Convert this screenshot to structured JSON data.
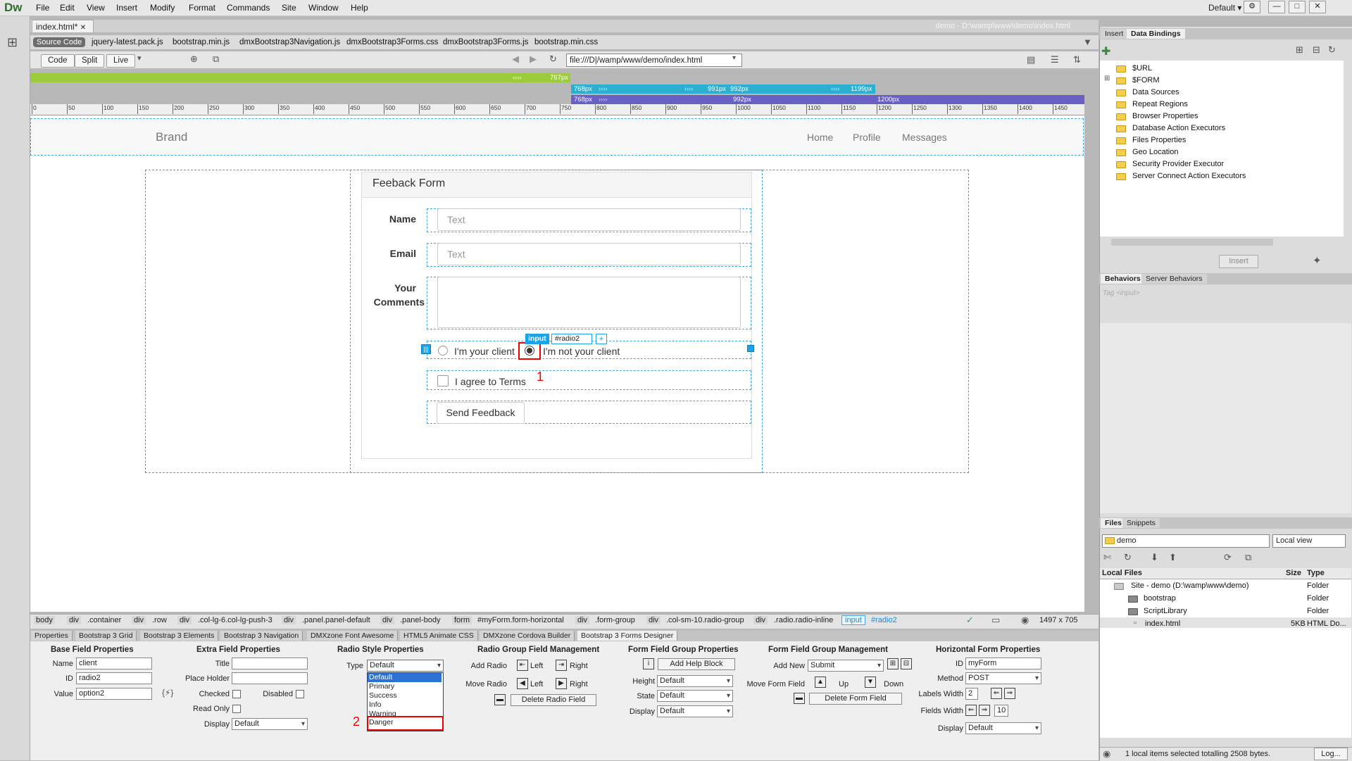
{
  "app": {
    "logo": "Dw",
    "menu": [
      "File",
      "Edit",
      "View",
      "Insert",
      "Modify",
      "Format",
      "Commands",
      "Site",
      "Window",
      "Help"
    ],
    "workspace": "Default"
  },
  "document": {
    "tab": "index.html*",
    "path": "demo - D:\\wamp\\www\\demo\\index.html",
    "related_files": [
      "Source Code",
      "jquery-latest.pack.js",
      "bootstrap.min.js",
      "dmxBootstrap3Navigation.js",
      "dmxBootstrap3Forms.css",
      "dmxBootstrap3Forms.js",
      "bootstrap.min.css"
    ],
    "view_buttons": [
      "Code",
      "Split",
      "Live"
    ],
    "address": "file:///D|/wamp/www/demo/index.html"
  },
  "media_queries": {
    "row1": "767px",
    "row2": [
      "768px",
      "991px",
      "992px",
      "1199px"
    ],
    "row3": [
      "768px",
      "992px",
      "1200px"
    ]
  },
  "ruler": [
    "0",
    "50",
    "100",
    "150",
    "200",
    "250",
    "300",
    "350",
    "400",
    "450",
    "500",
    "550",
    "600",
    "650",
    "700",
    "750",
    "800",
    "850",
    "900",
    "950",
    "1000",
    "1050",
    "1100",
    "1150",
    "1200",
    "1250",
    "1300",
    "1350",
    "1400",
    "1450"
  ],
  "page": {
    "brand": "Brand",
    "nav": [
      "Home",
      "Profile",
      "Messages"
    ],
    "panel_title": "Feeback Form",
    "fields": {
      "name_label": "Name",
      "name_placeholder": "Text",
      "email_label": "Email",
      "email_placeholder": "Text",
      "comments_label_1": "Your",
      "comments_label_2": "Comments"
    },
    "radios": [
      "I'm your client",
      "I'm not your client"
    ],
    "checkbox": "I agree to Terms",
    "submit": "Send Feedback",
    "selected_tag": "input",
    "selected_id": "#radio2",
    "annotation_1": "1",
    "annotation_2": "2"
  },
  "tag_selector": {
    "crumbs": [
      "body",
      "div",
      ".container",
      "div",
      ".row",
      "div",
      ".col-lg-6.col-lg-push-3",
      "div",
      ".panel.panel-default",
      "div",
      ".panel-body",
      "form",
      "#myForm.form-horizontal",
      "div",
      ".form-group",
      "div",
      ".col-sm-10.radio-group",
      "div",
      ".radio.radio-inline"
    ],
    "current_tag": "input",
    "current_id": "#radio2",
    "size": "1497 x 705"
  },
  "properties": {
    "tabs": [
      "Properties",
      "Bootstrap 3 Grid",
      "Bootstrap 3 Elements",
      "Bootstrap 3 Navigation",
      "DMXzone Font Awesome",
      "HTML5 Animate CSS",
      "DMXzone Cordova Builder",
      "Bootstrap 3 Forms Designer"
    ],
    "base": {
      "title": "Base Field Properties",
      "name_label": "Name",
      "name": "client",
      "id_label": "ID",
      "id": "radio2",
      "value_label": "Value",
      "value": "option2"
    },
    "extra": {
      "title": "Extra Field Properties",
      "title_label": "Title",
      "placeholder_label": "Place Holder",
      "checked_label": "Checked",
      "disabled_label": "Disabled",
      "readonly_label": "Read Only",
      "display_label": "Display",
      "display": "Default"
    },
    "radio_style": {
      "title": "Radio Style Properties",
      "type_label": "Type",
      "type": "Default",
      "options": [
        "Default",
        "Primary",
        "Success",
        "Info",
        "Warning",
        "Danger"
      ]
    },
    "radio_group": {
      "title": "Radio Group Field Management",
      "add_label": "Add Radio",
      "move_label": "Move Radio",
      "left": "Left",
      "right": "Right",
      "delete": "Delete Radio Field"
    },
    "form_group": {
      "title": "Form Field Group Properties",
      "help": "Add Help Block",
      "height_label": "Height",
      "height": "Default",
      "state_label": "State",
      "state": "Default",
      "display_label": "Display",
      "display": "Default"
    },
    "form_mgmt": {
      "title": "Form Field Group Management",
      "add_new_label": "Add New",
      "add_new": "Submit",
      "move_label": "Move Form Field",
      "up": "Up",
      "down": "Down",
      "delete": "Delete Form Field"
    },
    "horizontal": {
      "title": "Horizontal Form Properties",
      "id_label": "ID",
      "id": "myForm",
      "method_label": "Method",
      "method": "POST",
      "labels_width_label": "Labels Width",
      "labels_width": "2",
      "fields_width_label": "Fields Width",
      "fields_width": "10",
      "display_label": "Display",
      "display": "Default"
    }
  },
  "right_panel": {
    "tabs1": [
      "Insert",
      "Data Bindings"
    ],
    "bindings": [
      "$URL",
      "$FORM",
      "Data Sources",
      "Repeat Regions",
      "Browser Properties",
      "Database Action Executors",
      "Files Properties",
      "Geo Location",
      "Security Provider Executor",
      "Server Connect Action Executors"
    ],
    "insert_button": "Insert",
    "tabs2": [
      "Behaviors",
      "Server Behaviors"
    ],
    "tag_placeholder": "Tag <input>",
    "tabs3": [
      "Files",
      "Snippets"
    ],
    "site": "demo",
    "view": "Local view",
    "columns": [
      "Local Files",
      "Size",
      "Type"
    ],
    "files": [
      {
        "name": "Site - demo (D:\\wamp\\www\\demo)",
        "size": "",
        "type": "Folder"
      },
      {
        "name": "bootstrap",
        "size": "",
        "type": "Folder"
      },
      {
        "name": "ScriptLibrary",
        "size": "",
        "type": "Folder"
      },
      {
        "name": "index.html",
        "size": "5KB",
        "type": "HTML Do..."
      }
    ],
    "status": "1 local items selected totalling 2508 bytes.",
    "log": "Log..."
  }
}
